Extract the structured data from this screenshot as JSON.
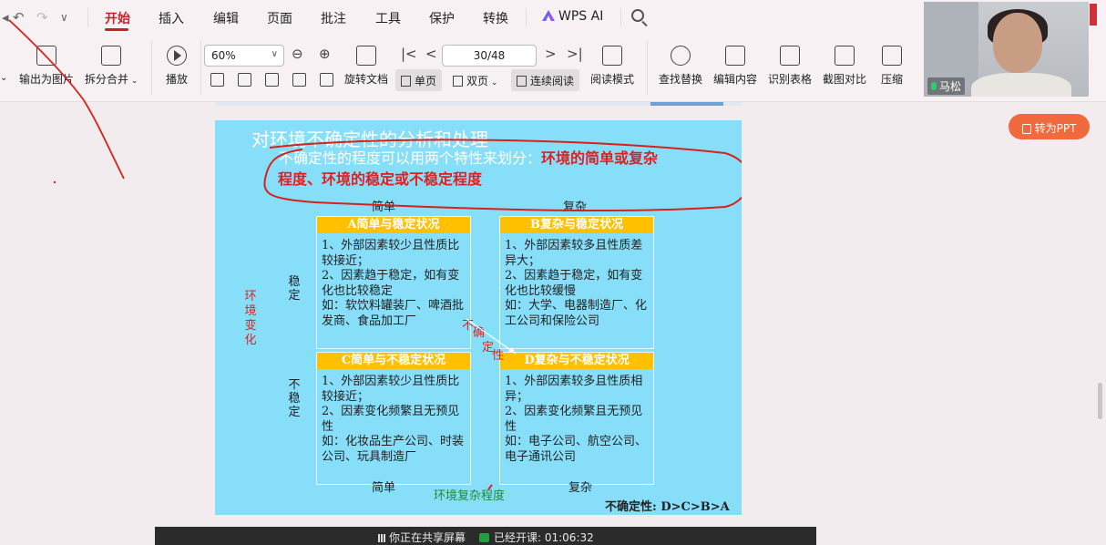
{
  "menubar": {
    "tabs": [
      "开始",
      "插入",
      "编辑",
      "页面",
      "批注",
      "工具",
      "保护",
      "转换"
    ],
    "active_tab": "开始",
    "ai_label": "WPS AI"
  },
  "toolbar": {
    "export_image": "输出为图片",
    "split_merge": "拆分合并",
    "play": "播放",
    "zoom": "60%",
    "rotate_doc": "旋转文档",
    "single_page": "单页",
    "double_page": "双页",
    "continuous": "连续阅读",
    "read_mode": "阅读模式",
    "page_indicator": "30/48",
    "find_replace": "查找替换",
    "edit_content": "编辑内容",
    "recognize_table": "识别表格",
    "screenshot_compare": "截图对比",
    "compress": "压缩"
  },
  "video": {
    "participant_name": "马松"
  },
  "convert_ppt_label": "转为PPT",
  "slide": {
    "title": "对环境不确定性的分析和处理",
    "subtitle_plain": "不确定性的程度可以用两个特性来划分：",
    "subtitle_emph_1": "环境的简单或复杂",
    "subtitle_emph_2": "程度、环境的稳定或不稳定程度",
    "top_simple": "简单",
    "top_complex": "复杂",
    "bottom_simple": "简单",
    "bottom_complex": "复杂",
    "stable": "稳定",
    "unstable": "不稳定",
    "env_change": "环境变化",
    "env_complexity": "环境复杂程度",
    "uncertainty_chars": [
      "不",
      "确",
      "定",
      "性"
    ],
    "box_a": {
      "header": "A简单与稳定状况",
      "body": "1、外部因素较少且性质比较接近；\n2、因素趋于稳定，如有变化也比较稳定\n如：软饮料罐装厂、啤酒批发商、食品加工厂"
    },
    "box_b": {
      "header": "B复杂与稳定状况",
      "body": "1、外部因素较多且性质差异大；\n2、因素趋于稳定，如有变化也比较缓慢\n如：大学、电器制造厂、化工公司和保险公司"
    },
    "box_c": {
      "header": "C简单与不稳定状况",
      "body": "1、外部因素较少且性质比较接近；\n2、因素变化频繁且无预见性\n如：化妆品生产公司、时装公司、玩具制造厂"
    },
    "box_d": {
      "header": "D复杂与不稳定状况",
      "body": "1、外部因素较多且性质相异；\n2、因素变化频繁且无预见性\n如：电子公司、航空公司、电子通讯公司"
    },
    "uncertainty_order": "不确定性: D>C>B>A"
  },
  "share_bar": {
    "sharing_text": "你正在共享屏幕",
    "class_started": "已经开课: 01:06:32"
  },
  "colors": {
    "accent_red": "#c8202a",
    "slide_bg": "#87def9",
    "box_header": "#ffc000",
    "convert_btn": "#f06a3e"
  }
}
